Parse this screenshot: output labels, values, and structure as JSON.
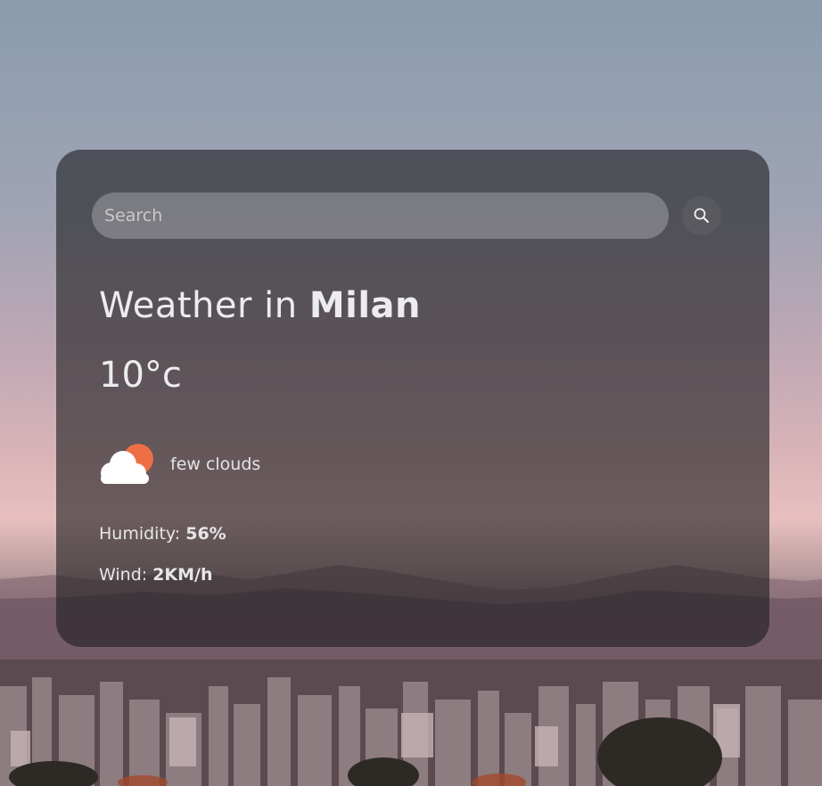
{
  "search": {
    "placeholder": "Search",
    "value": ""
  },
  "weather": {
    "title_prefix": "Weather in ",
    "city": "Milan",
    "temperature": "10°c",
    "condition_icon": "few-clouds-icon",
    "condition": "few clouds",
    "humidity_label": "Humidity: ",
    "humidity_value": "56%",
    "wind_label": "Wind: ",
    "wind_value": "2KM/h"
  },
  "colors": {
    "card_background": "#1e1e20",
    "sun": "#ee6f46",
    "cloud": "#ffffff"
  }
}
